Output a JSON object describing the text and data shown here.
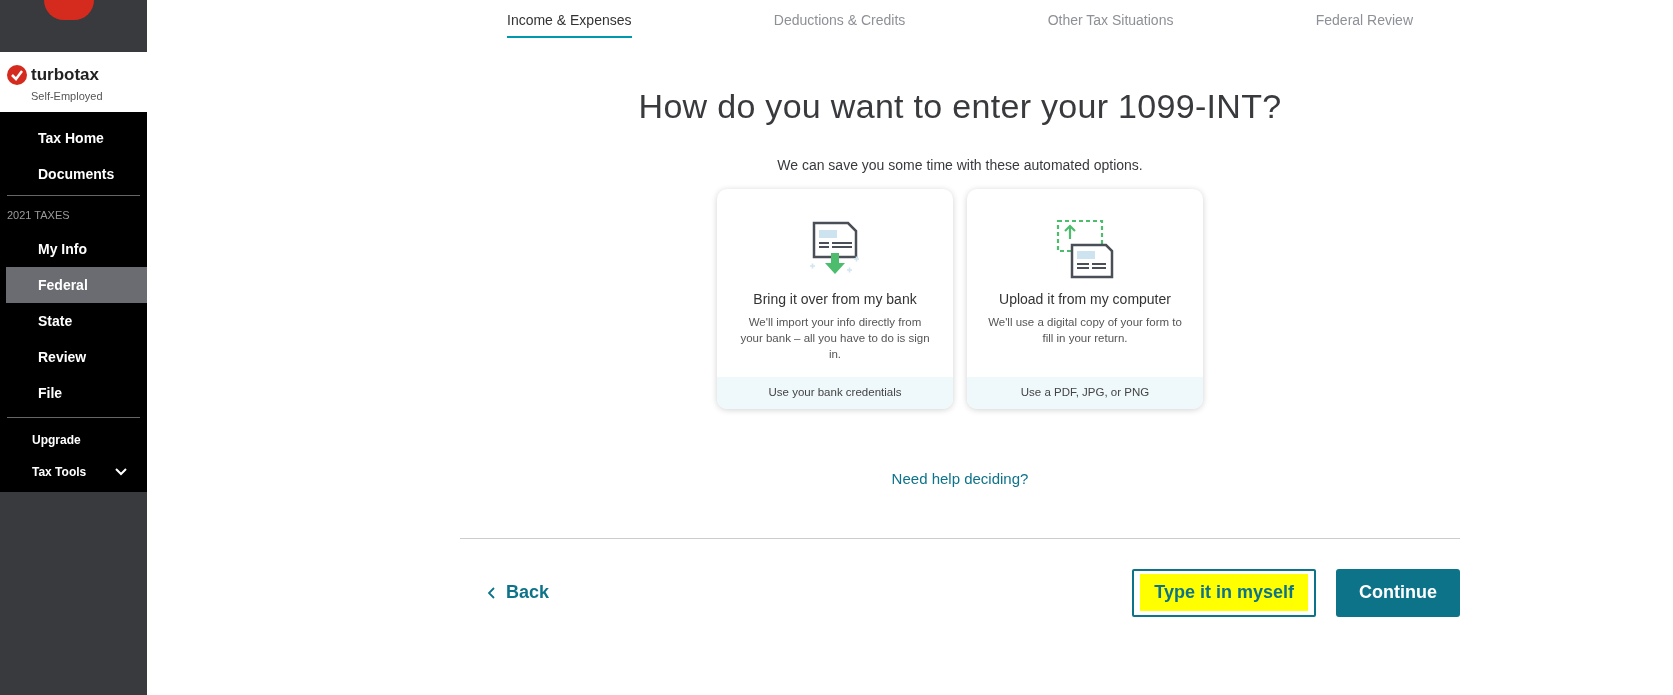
{
  "sidebar": {
    "brand": {
      "name": "turbotax",
      "edition": "Self-Employed"
    },
    "items": [
      {
        "label": "Tax Home",
        "selected": false
      },
      {
        "label": "Documents",
        "selected": false
      }
    ],
    "section_title": "2021 TAXES",
    "section_items": [
      {
        "label": "My Info",
        "selected": false
      },
      {
        "label": "Federal",
        "selected": true
      },
      {
        "label": "State",
        "selected": false
      },
      {
        "label": "Review",
        "selected": false
      },
      {
        "label": "File",
        "selected": false
      }
    ],
    "tools": [
      {
        "label": "Upgrade",
        "kind": "link"
      },
      {
        "label": "Tax Tools",
        "kind": "expander"
      }
    ]
  },
  "tabs": [
    {
      "label": "Income & Expenses",
      "selected": true
    },
    {
      "label": "Deductions & Credits",
      "selected": false
    },
    {
      "label": "Other Tax Situations",
      "selected": false
    },
    {
      "label": "Federal Review",
      "selected": false
    }
  ],
  "heading": "How do you want to enter your 1099-INT?",
  "subheading": "We can save you some time with these automated options.",
  "options": [
    {
      "kind": "bank",
      "title": "Bring it over from my bank",
      "description": "We'll import your info directly from your bank – all you have to do is sign in.",
      "footer": "Use your bank credentials"
    },
    {
      "kind": "upload",
      "title": "Upload it from my computer",
      "description": "We'll use a digital copy of your form to fill in your return.",
      "footer": "Use a PDF, JPG, or PNG"
    }
  ],
  "help_link": "Need help deciding?",
  "back_button": "Back",
  "manual_button": {
    "label": "Type it in myself",
    "highlighted": true
  },
  "continue_button": "Continue"
}
